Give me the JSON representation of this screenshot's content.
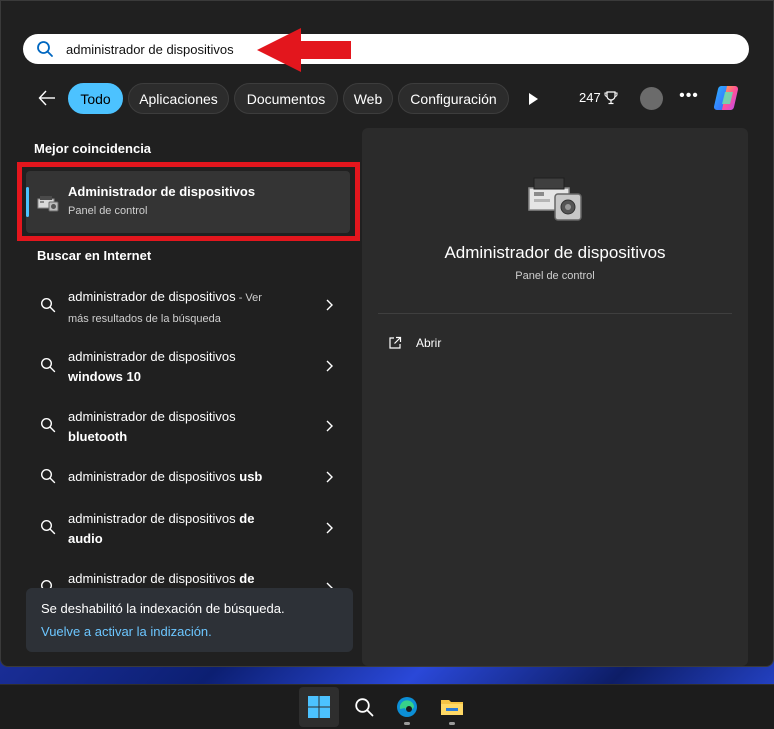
{
  "search": {
    "value": "administrador de dispositivos"
  },
  "filters": [
    {
      "label": "Todo",
      "active": true
    },
    {
      "label": "Aplicaciones",
      "active": false
    },
    {
      "label": "Documentos",
      "active": false
    },
    {
      "label": "Web",
      "active": false
    },
    {
      "label": "Configuración",
      "active": false
    }
  ],
  "toolbar": {
    "points": "247"
  },
  "best_match": {
    "section_title": "Mejor coincidencia",
    "title": "Administrador de dispositivos",
    "subtitle": "Panel de control"
  },
  "web": {
    "section_title": "Buscar en Internet",
    "items": [
      {
        "prefix": "administrador de dispositivos",
        "suffix": " - Ver",
        "line2": "más resultados de la búsqueda"
      },
      {
        "prefix": "administrador de dispositivos",
        "bold": "windows 10"
      },
      {
        "prefix": "administrador de dispositivos",
        "bold": "bluetooth"
      },
      {
        "prefix": "administrador de dispositivos ",
        "bold": "usb"
      },
      {
        "prefix": "administrador de dispositivos ",
        "bold_inline": "de",
        "bold": "audio"
      },
      {
        "prefix": "administrador de dispositivos ",
        "bold_inline": "de"
      }
    ]
  },
  "toast": {
    "message": "Se deshabilitó la indexación de búsqueda.",
    "link": "Vuelve a activar la indización."
  },
  "detail": {
    "title": "Administrador de dispositivos",
    "subtitle": "Panel de control",
    "open_label": "Abrir"
  },
  "colors": {
    "accent": "#4cc2ff",
    "annotation_red": "#e3161d"
  }
}
